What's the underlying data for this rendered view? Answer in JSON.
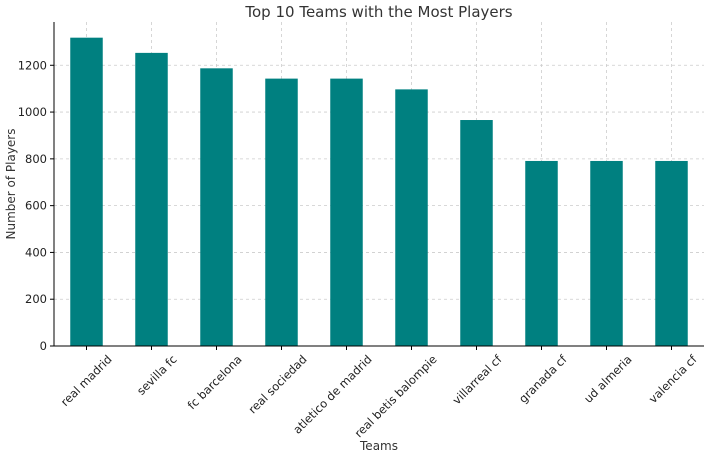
{
  "chart_data": {
    "type": "bar",
    "title": "Top 10 Teams with the Most Players",
    "xlabel": "Teams",
    "ylabel": "Number of Players",
    "categories": [
      "real madrid",
      "sevilla fc",
      "fc barcelona",
      "real sociedad",
      "atletico de madrid",
      "real betis balompie",
      "villarreal cf",
      "granada cf",
      "ud almeria",
      "valencia cf"
    ],
    "values": [
      1318,
      1253,
      1187,
      1143,
      1143,
      1097,
      966,
      791,
      791,
      791
    ],
    "yticks": [
      0,
      200,
      400,
      600,
      800,
      1000,
      1200
    ],
    "ylim": [
      0,
      1385
    ],
    "grid": true,
    "bar_color": "#008080"
  }
}
